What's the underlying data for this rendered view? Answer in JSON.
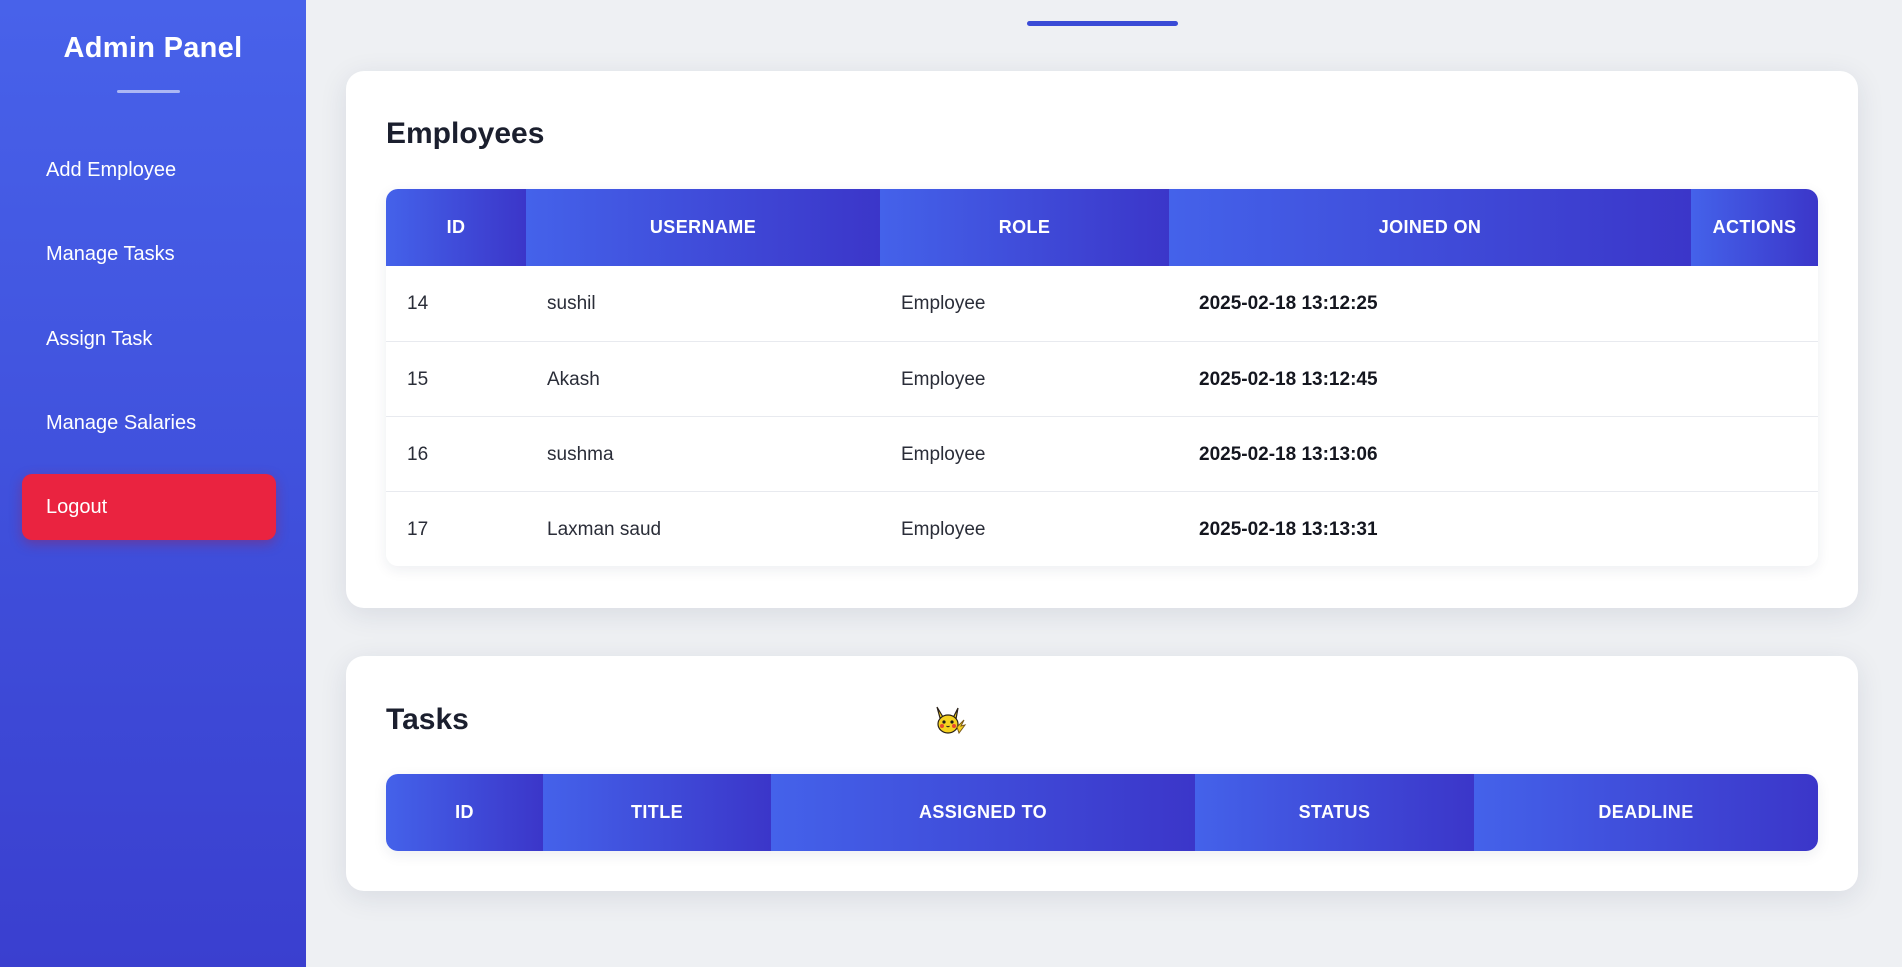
{
  "sidebar": {
    "title": "Admin Panel",
    "items": [
      {
        "label": "Add Employee"
      },
      {
        "label": "Manage Tasks"
      },
      {
        "label": "Assign Task"
      },
      {
        "label": "Manage Salaries"
      },
      {
        "label": "Logout"
      }
    ]
  },
  "employees": {
    "title": "Employees",
    "columns": [
      "ID",
      "USERNAME",
      "ROLE",
      "JOINED ON",
      "ACTIONS"
    ],
    "rows": [
      {
        "id": "14",
        "username": "sushil",
        "role": "Employee",
        "joined_on": "2025-02-18 13:12:25",
        "actions": ""
      },
      {
        "id": "15",
        "username": "Akash",
        "role": "Employee",
        "joined_on": "2025-02-18 13:12:45",
        "actions": ""
      },
      {
        "id": "16",
        "username": "sushma",
        "role": "Employee",
        "joined_on": "2025-02-18 13:13:06",
        "actions": ""
      },
      {
        "id": "17",
        "username": "Laxman saud",
        "role": "Employee",
        "joined_on": "2025-02-18 13:13:31",
        "actions": ""
      }
    ]
  },
  "tasks": {
    "title": "Tasks",
    "columns": [
      "ID",
      "TITLE",
      "ASSIGNED TO",
      "STATUS",
      "DEADLINE"
    ],
    "mascot_icon": "pikachu-icon"
  },
  "colors": {
    "sidebar": "#4862ea",
    "header_gradient_start": "#4462ea",
    "header_gradient_end": "#3b36c9",
    "logout": "#ea2340"
  }
}
